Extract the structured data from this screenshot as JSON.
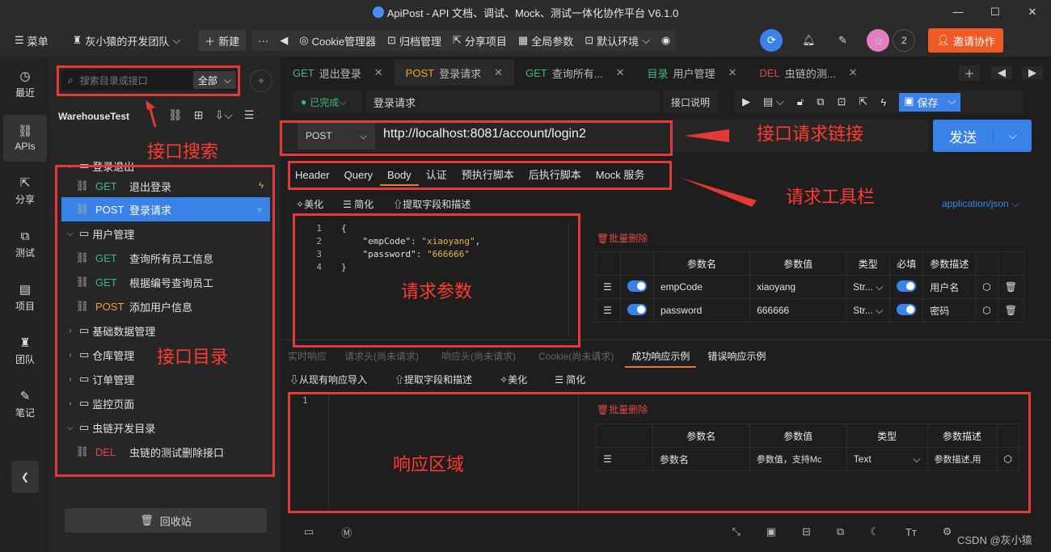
{
  "titlebar": {
    "title": "ApiPost - API 文档、调试、Mock、测试一体化协作平台 V6.1.0"
  },
  "topbar": {
    "menu": "菜单",
    "team": "灰小猿的开发团队",
    "new": "新建",
    "tools": [
      "Cookie管理器",
      "归档管理",
      "分享项目",
      "全局参数",
      "默认环境"
    ],
    "badge": "2",
    "invite": "邀请协作"
  },
  "leftnav": [
    "最近",
    "APIs",
    "分享",
    "测试",
    "项目",
    "团队",
    "笔记"
  ],
  "sidebar": {
    "search_placeholder": "搜索目录或接口",
    "scope": "全部",
    "project": "WarehouseTest",
    "trash": "回收站",
    "tree": [
      {
        "type": "folder",
        "label": "登录退出"
      },
      {
        "type": "api",
        "method": "GET",
        "label": "退出登录"
      },
      {
        "type": "api",
        "method": "POST",
        "label": "登录请求"
      },
      {
        "type": "folder",
        "label": "用户管理"
      },
      {
        "type": "api",
        "method": "GET",
        "label": "查询所有员工信息"
      },
      {
        "type": "api",
        "method": "GET",
        "label": "根据编号查询员工"
      },
      {
        "type": "api",
        "method": "POST",
        "label": "添加用户信息"
      },
      {
        "type": "folder",
        "label": "基础数据管理"
      },
      {
        "type": "folder",
        "label": "仓库管理"
      },
      {
        "type": "folder",
        "label": "订单管理"
      },
      {
        "type": "folder",
        "label": "监控页面"
      },
      {
        "type": "folder",
        "label": "虫链开发目录"
      },
      {
        "type": "api",
        "method": "DEL",
        "label": "虫链的测试删除接口"
      }
    ]
  },
  "tabs": [
    {
      "method": "GET",
      "label": "退出登录"
    },
    {
      "method": "POST",
      "label": "登录请求"
    },
    {
      "method": "GET",
      "label": "查询所有..."
    },
    {
      "method": "目录",
      "label": "用户管理"
    },
    {
      "method": "DEL",
      "label": "虫链的测..."
    }
  ],
  "request": {
    "status": "已完成",
    "name": "登录请求",
    "doc": "接口说明",
    "save": "保存",
    "method": "POST",
    "url": "http://localhost:8081/account/login2",
    "send": "发送",
    "subtabs": [
      "Header",
      "Query",
      "Body",
      "认证",
      "预执行脚本",
      "后执行脚本",
      "Mock 服务"
    ],
    "body_actions": [
      "美化",
      "简化",
      "提取字段和描述"
    ],
    "content_type": "application/json",
    "code_lines": [
      "{",
      "    \"empCode\": \"xiaoyang\",",
      "    \"password\": \"666666\"",
      "}"
    ],
    "line_numbers": [
      "1",
      "2",
      "3",
      "4"
    ],
    "batch_delete": "批量删除",
    "param_headers": [
      "参数名",
      "参数值",
      "类型",
      "必填",
      "参数描述"
    ],
    "params": [
      {
        "name": "empCode",
        "value": "xiaoyang",
        "type": "Str...",
        "desc": "用户名"
      },
      {
        "name": "password",
        "value": "666666",
        "type": "Str...",
        "desc": "密码"
      }
    ]
  },
  "response": {
    "tabs": [
      "实时响应",
      "请求头(尚未请求)",
      "响应头(尚未请求)",
      "Cookie(尚未请求)",
      "成功响应示例",
      "错误响应示例"
    ],
    "actions": [
      "从现有响应导入",
      "提取字段和描述",
      "美化",
      "简化"
    ],
    "line": "1",
    "batch_delete": "批量删除",
    "headers": [
      "参数名",
      "参数值",
      "类型",
      "参数描述"
    ],
    "row": {
      "name": "参数名",
      "value": "参数值，支持Mc",
      "type": "Text",
      "desc": "参数描述,用"
    }
  },
  "annotations": {
    "search": "接口搜索",
    "tree": "接口目录",
    "url": "接口请求链接",
    "toolbar": "请求工具栏",
    "params": "请求参数",
    "response": "响应区域"
  },
  "watermark": "CSDN @灰小猿"
}
